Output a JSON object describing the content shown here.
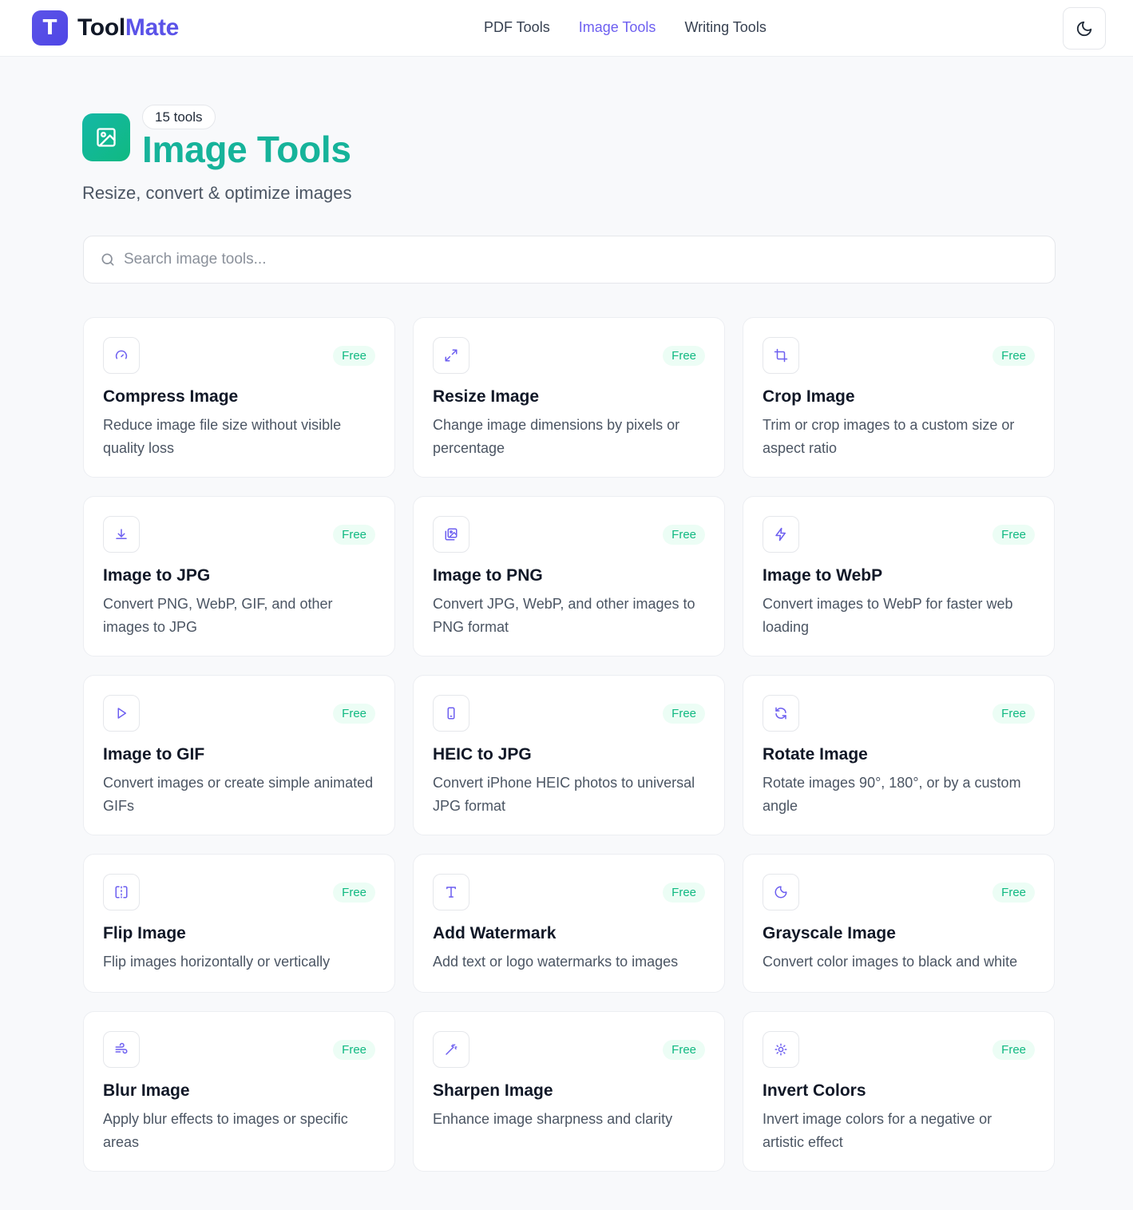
{
  "header": {
    "logo_icon": "T",
    "logo_part1": "Tool",
    "logo_part2": "Mate",
    "nav": [
      "PDF Tools",
      "Image Tools",
      "Writing Tools"
    ],
    "active_nav": "Image Tools",
    "theme_toggle_icon": "moon-icon"
  },
  "hero": {
    "icon": "image-icon",
    "count": "15 tools",
    "title": "Image Tools",
    "subtitle": "Resize, convert & optimize images"
  },
  "search": {
    "placeholder": "Search image tools...",
    "value": ""
  },
  "badge_label": "Free",
  "colors": {
    "brand": "#4f46e5",
    "accent": "#6d5ff0",
    "title_teal": "#16b39a",
    "free_green": "#10b981"
  },
  "tools": [
    {
      "title": "Compress Image",
      "desc": "Reduce image file size without visible quality loss",
      "icon": "gauge-icon"
    },
    {
      "title": "Resize Image",
      "desc": "Change image dimensions by pixels or percentage",
      "icon": "expand-icon"
    },
    {
      "title": "Crop Image",
      "desc": "Trim or crop images to a custom size or aspect ratio",
      "icon": "crop-icon"
    },
    {
      "title": "Image to JPG",
      "desc": "Convert PNG, WebP, GIF, and other images to JPG",
      "icon": "download-icon"
    },
    {
      "title": "Image to PNG",
      "desc": "Convert JPG, WebP, and other images to PNG format",
      "icon": "images-icon"
    },
    {
      "title": "Image to WebP",
      "desc": "Convert images to WebP for faster web loading",
      "icon": "zap-icon"
    },
    {
      "title": "Image to GIF",
      "desc": "Convert images or create simple animated GIFs",
      "icon": "play-icon"
    },
    {
      "title": "HEIC to JPG",
      "desc": "Convert iPhone HEIC photos to universal JPG format",
      "icon": "phone-icon"
    },
    {
      "title": "Rotate Image",
      "desc": "Rotate images 90°, 180°, or by a custom angle",
      "icon": "rotate-icon"
    },
    {
      "title": "Flip Image",
      "desc": "Flip images horizontally or vertically",
      "icon": "flip-icon"
    },
    {
      "title": "Add Watermark",
      "desc": "Add text or logo watermarks to images",
      "icon": "type-icon"
    },
    {
      "title": "Grayscale Image",
      "desc": "Convert color images to black and white",
      "icon": "contrast-icon"
    },
    {
      "title": "Blur Image",
      "desc": "Apply blur effects to images or specific areas",
      "icon": "wind-icon"
    },
    {
      "title": "Sharpen Image",
      "desc": "Enhance image sharpness and clarity",
      "icon": "wand-icon"
    },
    {
      "title": "Invert Colors",
      "desc": "Invert image colors for a negative or artistic effect",
      "icon": "sun-icon"
    }
  ]
}
